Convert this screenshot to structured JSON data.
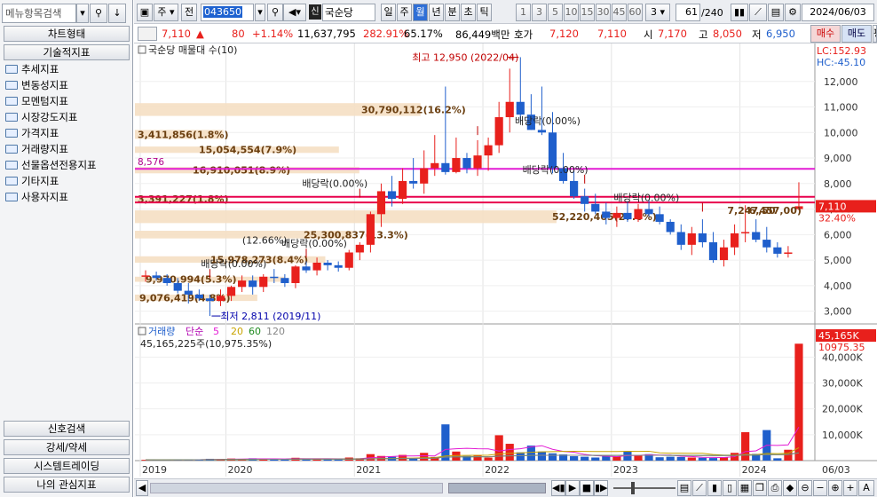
{
  "left_panel": {
    "search_placeholder": "메뉴항목검색",
    "chart_type_header": "차트형태",
    "indicators_header": "기술적지표",
    "tree": [
      "추세지표",
      "변동성지표",
      "모멘텀지표",
      "시장강도지표",
      "가격지표",
      "거래량지표",
      "선물옵션전용지표",
      "기타지표",
      "사용자지표"
    ],
    "bottom": [
      "신호검색",
      "강세/약세",
      "시스템트레이딩",
      "나의 관심지표"
    ]
  },
  "toolbar": {
    "period_mode": "주",
    "prev": "전",
    "code": "043650",
    "stock_name": "국순당",
    "intervals": [
      "일",
      "주",
      "월",
      "년",
      "분",
      "초",
      "틱"
    ],
    "active_interval": "월",
    "counts": [
      "1",
      "3",
      "5",
      "10",
      "15",
      "30",
      "45",
      "60"
    ],
    "count_select": "3",
    "position": "61",
    "total": "/240",
    "date": "2024/06/03"
  },
  "quote": {
    "price": "7,110",
    "arrow": "▲",
    "change": "80",
    "pct": "+1.14%",
    "volume": "11,637,795",
    "vol_ratio": "282.91%",
    "ratio2": "65.17%",
    "amount": "86,449백만",
    "ask_label": "호가",
    "ask": "7,120",
    "bid": "7,110",
    "open_label": "시",
    "open": "7,170",
    "high_label": "고",
    "high": "8,050",
    "low_label": "저",
    "low": "6,950",
    "sell": "매수",
    "buy": "매도",
    "eval": "평"
  },
  "price_panel": {
    "title": "국순당 매물대 수(10)",
    "lc": "LC:152.93",
    "hc": "HC:-45.10",
    "yticks": [
      "12,000",
      "11,000",
      "10,000",
      "9,000",
      "8,000",
      "7,000",
      "6,000",
      "5,000",
      "4,000",
      "3,000"
    ],
    "high_note": "최고 12,950 (2022/04)",
    "low_note": "최저 2,811 (2019/11)",
    "level_8576": "8,576",
    "current_price": "7,110",
    "current_pct": "32.40%",
    "dividend": "배당락(0.00%)",
    "dividend_pct2": "(12.66%)",
    "bands": [
      "30,790,112(16.2%)",
      "3,411,856(1.8%)",
      "15,054,554(7.9%)",
      "16,910,051(8.9%)",
      "3,391,227(1.8%)",
      "52,220,465(27.6%)",
      "25,300,837(13.3%)",
      "15,978,273(8.4%)",
      "9,970,994(5.3%)",
      "9,076,419(4.8%)"
    ],
    "side_vals": [
      "7,247,50",
      "6,457,00)"
    ]
  },
  "volume_panel": {
    "title": "거래량",
    "ma_label": "단순",
    "ma_values": [
      "5",
      "20",
      "60",
      "120"
    ],
    "current": "45,165,225주(10,975.35%)",
    "tag1": "45,165K",
    "tag2": "10975.35",
    "yticks": [
      "40,000K",
      "30,000K",
      "20,000K",
      "10,000K"
    ]
  },
  "xaxis": [
    "2019",
    "2020",
    "2021",
    "2022",
    "2023",
    "2024",
    "06/03"
  ],
  "colors": {
    "up": "#e8201c",
    "down": "#1f5fcc",
    "magenta": "#e31bd4",
    "accent": "#0000cc"
  },
  "chart_data": {
    "type": "candlestick",
    "x": [
      "2019-05",
      "2019-06",
      "2019-07",
      "2019-08",
      "2019-09",
      "2019-10",
      "2019-11",
      "2019-12",
      "2020-01",
      "2020-02",
      "2020-03",
      "2020-04",
      "2020-05",
      "2020-06",
      "2020-07",
      "2020-08",
      "2020-09",
      "2020-10",
      "2020-11",
      "2020-12",
      "2021-01",
      "2021-02",
      "2021-03",
      "2021-04",
      "2021-05",
      "2021-06",
      "2021-07",
      "2021-08",
      "2021-09",
      "2021-10",
      "2021-11",
      "2021-12",
      "2022-01",
      "2022-02",
      "2022-03",
      "2022-04",
      "2022-05",
      "2022-06",
      "2022-07",
      "2022-08",
      "2022-09",
      "2022-10",
      "2022-11",
      "2022-12",
      "2023-01",
      "2023-02",
      "2023-03",
      "2023-04",
      "2023-05",
      "2023-06",
      "2023-07",
      "2023-08",
      "2023-09",
      "2023-10",
      "2023-11",
      "2023-12",
      "2024-01",
      "2024-02",
      "2024-03",
      "2024-04",
      "2024-05",
      "2024-06"
    ],
    "series": [
      {
        "name": "open",
        "values": [
          4350,
          4400,
          4300,
          4100,
          3800,
          3650,
          3500,
          3400,
          3600,
          3950,
          4200,
          3950,
          4350,
          4300,
          4100,
          4750,
          4600,
          4900,
          4800,
          4700,
          5300,
          5600,
          6800,
          7700,
          7400,
          8100,
          8000,
          8600,
          8800,
          8450,
          9000,
          8600,
          9100,
          9500,
          10600,
          11200,
          10700,
          10100,
          10000,
          8600,
          8100,
          7500,
          7200,
          6900,
          6650,
          6850,
          6600,
          7000,
          6800,
          6500,
          6100,
          5600,
          6050,
          5700,
          5000,
          5500,
          6050,
          6100,
          5800,
          5500,
          5250,
          7000
        ]
      },
      {
        "name": "high",
        "values": [
          4600,
          4550,
          4450,
          4300,
          4100,
          3850,
          3650,
          3850,
          4000,
          4400,
          4400,
          4450,
          4650,
          4450,
          4800,
          4950,
          5100,
          5000,
          4950,
          5400,
          5700,
          6900,
          8000,
          8300,
          8600,
          9000,
          9300,
          9900,
          11800,
          9800,
          9200,
          9700,
          9800,
          11200,
          12500,
          12950,
          11500,
          11800,
          10800,
          9200,
          8500,
          7800,
          7600,
          7250,
          7100,
          7300,
          7200,
          7350,
          7100,
          6600,
          6400,
          6300,
          6600,
          6100,
          5800,
          6400,
          7150,
          6600,
          6300,
          5700,
          5550,
          8050
        ]
      },
      {
        "name": "low",
        "values": [
          4150,
          4200,
          4000,
          3700,
          3300,
          3400,
          2811,
          3200,
          3400,
          3750,
          3650,
          3750,
          4100,
          3950,
          3900,
          4500,
          4400,
          4600,
          4550,
          4600,
          5000,
          5300,
          6300,
          7100,
          7200,
          7800,
          7600,
          8300,
          8350,
          8400,
          8400,
          8300,
          8500,
          9200,
          10000,
          10400,
          10100,
          9900,
          8400,
          8000,
          7400,
          6900,
          6800,
          6400,
          6300,
          6500,
          6500,
          6700,
          6400,
          6000,
          5400,
          5200,
          5500,
          4900,
          4750,
          5200,
          5700,
          5700,
          5300,
          5100,
          5100,
          6950
        ]
      },
      {
        "name": "close",
        "values": [
          4400,
          4300,
          4100,
          3800,
          3650,
          3500,
          3400,
          3600,
          3950,
          4200,
          3950,
          4350,
          4300,
          4100,
          4750,
          4600,
          4900,
          4800,
          4700,
          5300,
          5600,
          6800,
          7700,
          7400,
          8100,
          8000,
          8600,
          8800,
          8450,
          9000,
          8600,
          9100,
          9500,
          10600,
          11200,
          10700,
          10100,
          10000,
          8600,
          8100,
          7500,
          7200,
          6900,
          6650,
          6850,
          6600,
          7000,
          6800,
          6500,
          6100,
          5600,
          6050,
          5700,
          5000,
          5500,
          6050,
          6100,
          5800,
          5500,
          5250,
          5300,
          7110
        ]
      },
      {
        "name": "volume",
        "values": [
          300,
          250,
          200,
          400,
          350,
          500,
          700,
          400,
          800,
          600,
          900,
          700,
          500,
          600,
          1100,
          800,
          600,
          500,
          400,
          1200,
          900,
          2500,
          1800,
          1500,
          2200,
          1000,
          3000,
          1400,
          14000,
          3500,
          1800,
          2200,
          1200,
          9800,
          6500,
          3200,
          5800,
          3500,
          2800,
          2400,
          1700,
          1500,
          1200,
          1800,
          1600,
          3500,
          1900,
          2500,
          1300,
          1500,
          1400,
          1200,
          1100,
          1000,
          1300,
          3000,
          11000,
          2600,
          11800,
          900,
          4200,
          45165
        ]
      }
    ],
    "ylim": [
      2500,
      13000
    ]
  }
}
